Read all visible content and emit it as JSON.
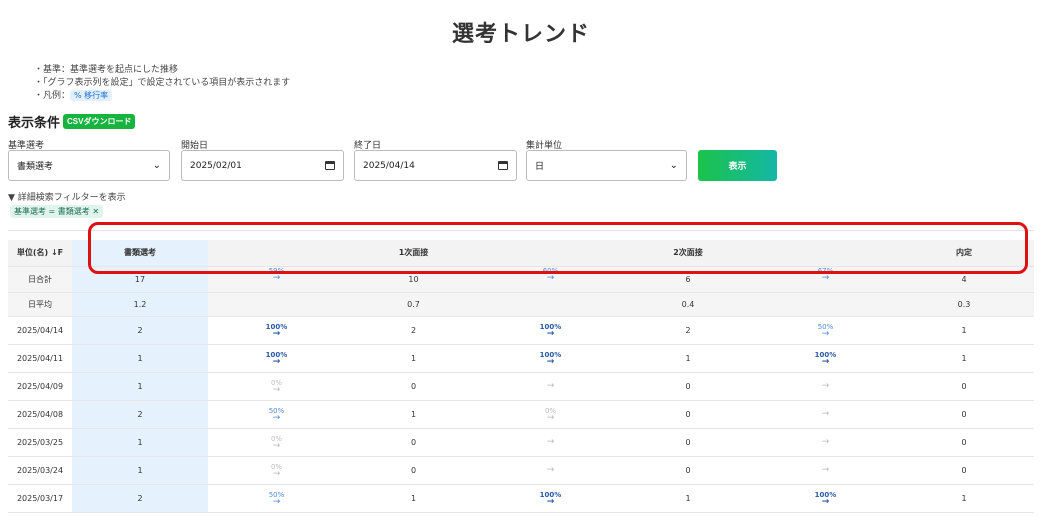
{
  "title": "選考トレンド",
  "notes": [
    "・基準：基準選考を起点にした推移",
    "・「グラフ表示列を設定」で設定されている項目が表示されます"
  ],
  "legend_prefix": "・凡例：",
  "legend_chip": "% 移行率",
  "conditions_title": "表示条件",
  "csv_button": "CSVダウンロード",
  "fields": {
    "base_label": "基準選考",
    "base_value": "書類選考",
    "start_label": "開始日",
    "start_value": "2025/02/01",
    "end_label": "終了日",
    "end_value": "2025/04/14",
    "unit_label": "集計単位",
    "unit_value": "日"
  },
  "show_button": "表示",
  "filter_toggle": "▼ 詳細検索フィルターを表示",
  "filter_chip": "基準選考 = 書類選考",
  "table": {
    "headers": {
      "unit": "単位(名)",
      "s1": "書類選考",
      "s2": "1次面接",
      "s3": "2次面接",
      "s4": "内定"
    },
    "sum_row": {
      "label": "日合計",
      "s1": "17",
      "r1": "59%",
      "s2": "10",
      "r2": "60%",
      "s3": "6",
      "r3": "67%",
      "s4": "4"
    },
    "avg_row": {
      "label": "日平均",
      "s1": "1.2",
      "s2": "0.7",
      "s3": "0.4",
      "s4": "0.3"
    },
    "rows": [
      {
        "date": "2025/04/14",
        "s1": "2",
        "r1": "100%",
        "s2": "2",
        "r2": "100%",
        "s3": "2",
        "r3": "50%",
        "s4": "1"
      },
      {
        "date": "2025/04/11",
        "s1": "1",
        "r1": "100%",
        "s2": "1",
        "r2": "100%",
        "s3": "1",
        "r3": "100%",
        "s4": "1"
      },
      {
        "date": "2025/04/09",
        "s1": "1",
        "r1": "0%",
        "s2": "0",
        "r2": "",
        "s3": "0",
        "r3": "",
        "s4": "0"
      },
      {
        "date": "2025/04/08",
        "s1": "2",
        "r1": "50%",
        "s2": "1",
        "r2": "0%",
        "s3": "0",
        "r3": "",
        "s4": "0"
      },
      {
        "date": "2025/03/25",
        "s1": "1",
        "r1": "0%",
        "s2": "0",
        "r2": "",
        "s3": "0",
        "r3": "",
        "s4": "0"
      },
      {
        "date": "2025/03/24",
        "s1": "1",
        "r1": "0%",
        "s2": "0",
        "r2": "",
        "s3": "0",
        "r3": "",
        "s4": "0"
      },
      {
        "date": "2025/03/17",
        "s1": "2",
        "r1": "50%",
        "s2": "1",
        "r2": "100%",
        "s3": "1",
        "r3": "100%",
        "s4": "1"
      }
    ]
  },
  "colors": {
    "highlight_box": "#e01010",
    "csv_green": "#16b33e",
    "rate_blue": "#2a5ba8",
    "column_highlight": "#e5f1fd"
  }
}
